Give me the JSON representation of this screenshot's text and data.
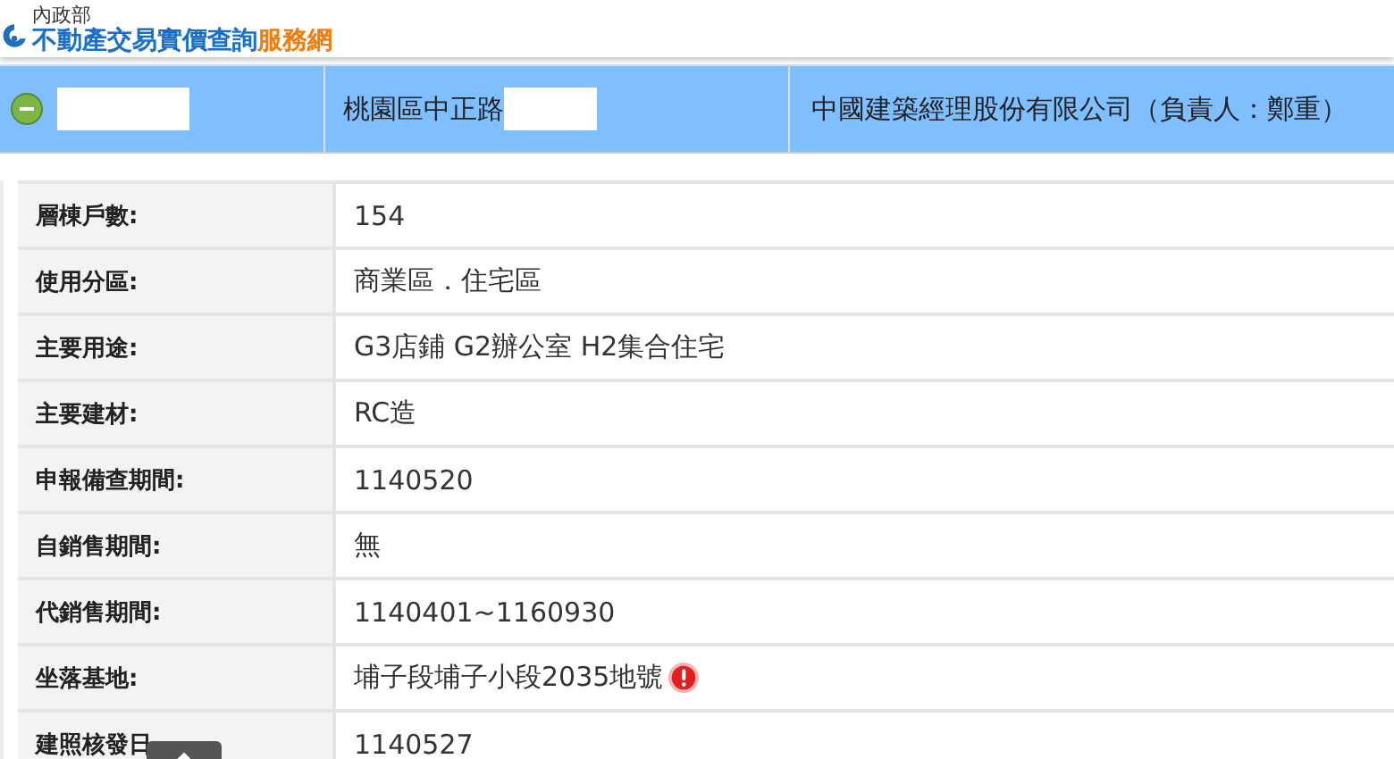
{
  "header": {
    "agency": "內政部",
    "title_main": "不動產交易實價查詢",
    "title_accent": "服務網"
  },
  "result_row": {
    "selected": true,
    "expanded": true,
    "address": "桃園區中正路",
    "company": "中國建築經理股份有限公司（負責人：鄭重）"
  },
  "details": [
    {
      "label": "層棟戶數:",
      "value": "154"
    },
    {
      "label": "使用分區:",
      "value": "商業區．住宅區"
    },
    {
      "label": "主要用途:",
      "value": "G3店鋪 G2辦公室 H2集合住宅"
    },
    {
      "label": "主要建材:",
      "value": "RC造"
    },
    {
      "label": "申報備查期間:",
      "value": "1140520"
    },
    {
      "label": "自銷售期間:",
      "value": "無"
    },
    {
      "label": "代銷售期間:",
      "value": "1140401~1160930"
    },
    {
      "label": "坐落基地:",
      "value": "埔子段埔子小段2035地號",
      "alert": true
    },
    {
      "label": "建照核發日",
      "value": "1140527"
    }
  ]
}
